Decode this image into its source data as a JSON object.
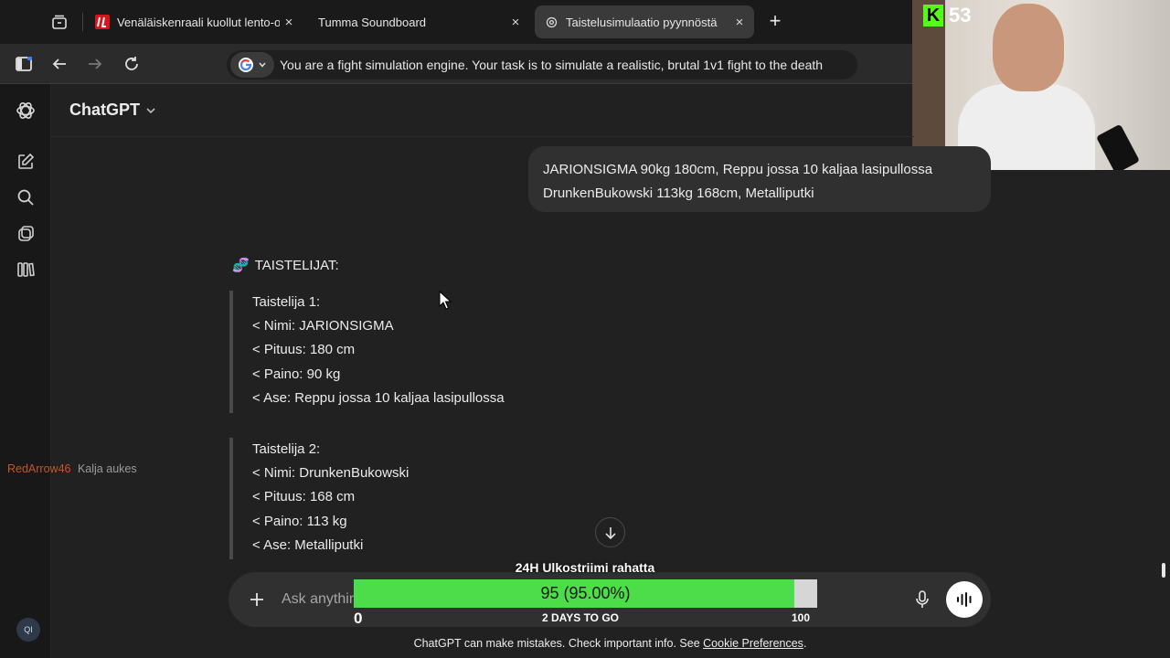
{
  "browser": {
    "tabs": [
      {
        "title": "Venäläiskenraali kuollut lento-o",
        "favicon": "IL",
        "favicon_color": "#d6151c",
        "active": false
      },
      {
        "title": "Tumma Soundboard",
        "favicon": "",
        "active": false
      },
      {
        "title": "Taistelusimulaatio pyynnöstä",
        "favicon": "chatgpt",
        "active": true
      }
    ],
    "new_tab_label": "+",
    "close_label": "×",
    "address_bar_text": "You are a fight simulation engine.  Your task is to simulate a realistic, brutal 1v1 fight to the death"
  },
  "stream": {
    "platform_icon": "K",
    "viewer_count": "53",
    "brand_color": "#53fc18",
    "chat": {
      "user": "RedArrow46",
      "message": "Kalja aukes"
    },
    "goal": {
      "title": "24H Ulkostriimi rahatta",
      "current_label": "95 (95.00%)",
      "progress": 0.95,
      "min": "0",
      "max": "100",
      "subtitle": "2 DAYS TO GO",
      "fill_color": "#4ddc4a"
    }
  },
  "app": {
    "model_label": "ChatGPT",
    "sidebar_icons": [
      "chatgpt-logo-icon",
      "new-chat-icon",
      "search-icon",
      "gpts-icon",
      "library-icon"
    ],
    "user_initials": "QI",
    "user_message": {
      "line1": "JARIONSIGMA 90kg 180cm, Reppu jossa 10 kaljaa lasipullossa",
      "line2": "DrunkenBukowski 113kg 168cm, Metalliputki"
    },
    "assistant": {
      "heading_emoji": "🧬",
      "heading": "TAISTELIJAT:",
      "fighters": [
        {
          "title": "Taistelija 1:",
          "name": "< Nimi: JARIONSIGMA",
          "height": "< Pituus: 180 cm",
          "weight": "< Paino: 90 kg",
          "weapon": "< Ase: Reppu jossa 10 kaljaa lasipullossa"
        },
        {
          "title": "Taistelija 2:",
          "name": "< Nimi: DrunkenBukowski",
          "height": "< Pituus: 168 cm",
          "weight": "< Paino: 113 kg",
          "weapon": "< Ase: Metalliputki"
        }
      ]
    },
    "composer": {
      "placeholder": "Ask anything"
    },
    "disclaimer": "ChatGPT can make mistakes. Check important info. See",
    "disclaimer_link": "Cookie Preferences",
    "disclaimer_end": "."
  }
}
